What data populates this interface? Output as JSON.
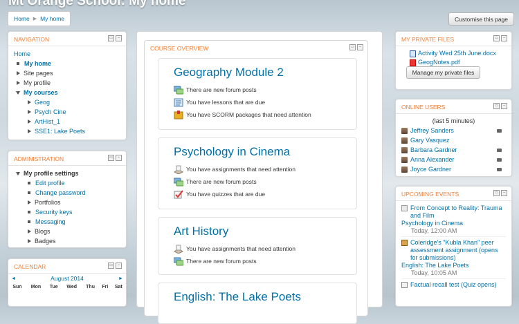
{
  "site": {
    "title": "Mt Orange School: My home"
  },
  "breadcrumb": {
    "home": "Home",
    "current": "My home"
  },
  "header": {
    "customise_label": "Customise this page"
  },
  "navigation": {
    "title": "NAVIGATION",
    "home": "Home",
    "my_home": "My home",
    "site_pages": "Site pages",
    "my_profile": "My profile",
    "my_courses": "My courses",
    "courses": [
      "Geog",
      "Psych Cine",
      "ArtHist_1",
      "SSE1: Lake Poets"
    ]
  },
  "administration": {
    "title": "ADMINISTRATION",
    "profile_settings": "My profile settings",
    "items": [
      "Edit profile",
      "Change password",
      "Portfolios",
      "Security keys",
      "Messaging",
      "Blogs",
      "Badges"
    ]
  },
  "calendar": {
    "title": "CALENDAR",
    "prev": "◄",
    "month": "August 2014",
    "next": "►",
    "days": [
      "Sun",
      "Mon",
      "Tue",
      "Wed",
      "Thu",
      "Fri",
      "Sat"
    ]
  },
  "course_overview": {
    "title": "COURSE OVERVIEW",
    "courses": [
      {
        "name": "Geography Module 2",
        "items": [
          "There are new forum posts",
          "You have lessons that are due",
          "You have SCORM packages that need attention"
        ]
      },
      {
        "name": "Psychology in Cinema",
        "items": [
          "You have assignments that need attention",
          "There are new forum posts",
          "You have quizzes that are due"
        ]
      },
      {
        "name": "Art History",
        "items": [
          "You have assignments that need attention",
          "There are new forum posts"
        ]
      },
      {
        "name": "English: The Lake Poets",
        "items": []
      }
    ]
  },
  "private_files": {
    "title": "MY PRIVATE FILES",
    "files": [
      "Activity Wed 25th June.docx",
      "GeogNotes.pdf"
    ],
    "manage_label": "Manage my private files"
  },
  "online_users": {
    "title": "ONLINE USERS",
    "period": "(last 5 minutes)",
    "users": [
      "Jeffrey Sanders",
      "Gary Vasquez",
      "Barbara Gardner",
      "Anna Alexander",
      "Joyce Gardner"
    ]
  },
  "upcoming_events": {
    "title": "UPCOMING EVENTS",
    "events": [
      {
        "title": "From Concept to Reality: Trauma and Film",
        "course": "Psychology in Cinema",
        "time": "Today, 12:00 AM"
      },
      {
        "title": "Coleridge's \"Kubla Khan\" peer assessment assignment (opens for submissions)",
        "course": "English: The Lake Poets",
        "time": "Today, 10:05 AM"
      },
      {
        "title": "Factual recall test (Quiz opens)",
        "course": "",
        "time": ""
      }
    ]
  },
  "colors": {
    "accent": "#f47c30",
    "link": "#0070a8"
  }
}
